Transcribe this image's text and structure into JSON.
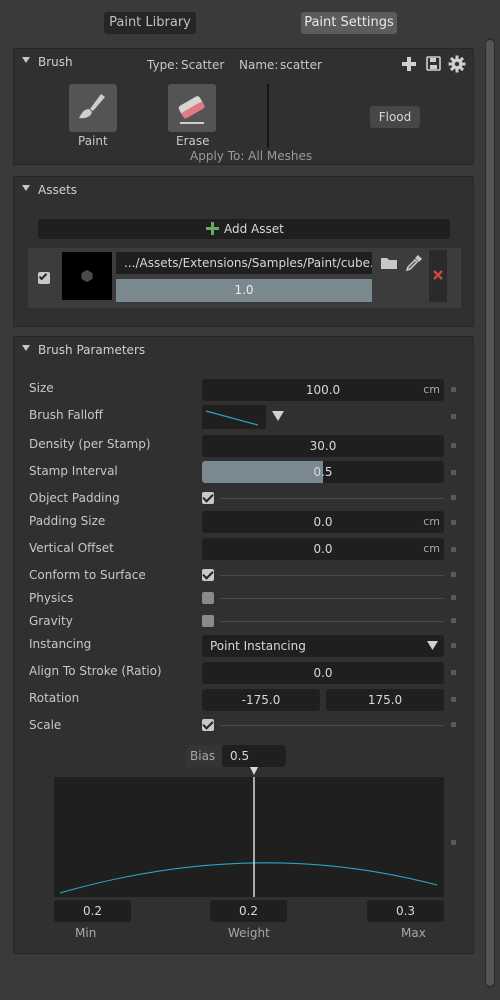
{
  "tabs": {
    "paint_library": "Paint Library",
    "paint_settings": "Paint Settings"
  },
  "brush": {
    "title": "Brush",
    "type_label": "Type:",
    "type_value": "Scatter",
    "name_label": "Name:",
    "name_value": "scatter",
    "tools": [
      {
        "label": "Paint"
      },
      {
        "label": "Erase"
      }
    ],
    "flood_label": "Flood",
    "apply_to": "Apply To: All Meshes"
  },
  "assets": {
    "title": "Assets",
    "add_label": "Add Asset",
    "path": ".../Assets/Extensions/Samples/Paint/cube.usd",
    "weight": "1.0"
  },
  "params": {
    "title": "Brush Parameters",
    "size_label": "Size",
    "size_value": "100.0",
    "size_unit": "cm",
    "falloff_label": "Brush Falloff",
    "density_label": "Density (per Stamp)",
    "density_value": "30.0",
    "stamp_label": "Stamp Interval",
    "stamp_value": "0.5",
    "stamp_fraction": 0.5,
    "padding_label": "Object Padding",
    "padding_checked": true,
    "padsize_label": "Padding Size",
    "padsize_value": "0.0",
    "padsize_unit": "cm",
    "voffset_label": "Vertical Offset",
    "voffset_value": "0.0",
    "voffset_unit": "cm",
    "conform_label": "Conform to Surface",
    "conform_checked": true,
    "physics_label": "Physics",
    "physics_checked": false,
    "gravity_label": "Gravity",
    "gravity_checked": false,
    "instancing_label": "Instancing",
    "instancing_value": "Point Instancing",
    "align_label": "Align To Stroke (Ratio)",
    "align_value": "0.0",
    "rotation_label": "Rotation",
    "rotation_min": "-175.0",
    "rotation_max": "175.0",
    "scale_label": "Scale",
    "scale_checked": true,
    "bias_label": "Bias",
    "bias_value": "0.5",
    "min_value": "0.2",
    "weight_value": "0.2",
    "max_value": "0.3",
    "min_label": "Min",
    "weight_label": "Weight",
    "max_label": "Max"
  },
  "colors": {
    "curve": "#2aa3c8",
    "add_plus": "#5fae5f",
    "delete_x": "#c84848",
    "weight_bar": "#7a8890"
  }
}
